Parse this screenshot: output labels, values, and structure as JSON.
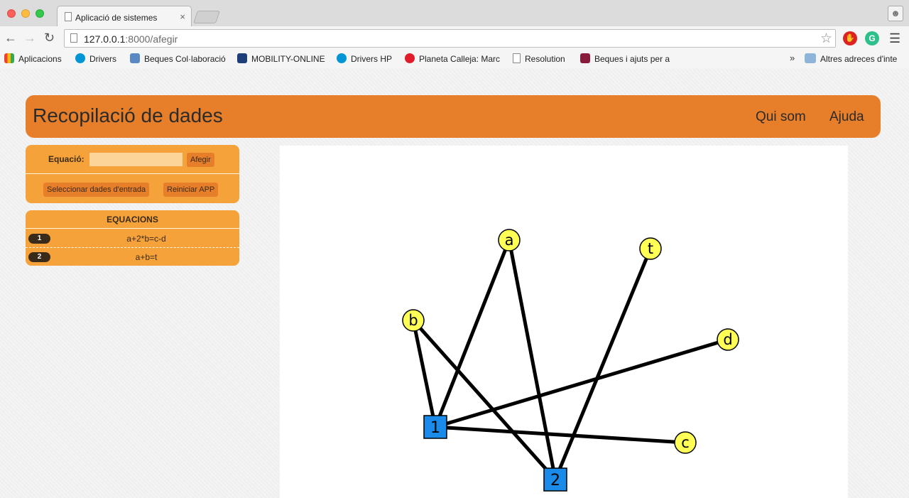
{
  "browser": {
    "tab_title": "Aplicació de sistemes",
    "tab_close": "×",
    "url_host": "127.0.0.1",
    "url_path": ":8000/afegir",
    "bookmarks": [
      {
        "label": "Aplicacions",
        "icon": "apps-grid-icon",
        "color": "#4285f4"
      },
      {
        "label": "Drivers",
        "icon": "hp-logo-icon",
        "color": "#0096d6"
      },
      {
        "label": "Beques Col·laboració",
        "icon": "ministry-logo-icon",
        "color": "#5a8ac6"
      },
      {
        "label": "MOBILITY-ONLINE",
        "icon": "mobility-logo-icon",
        "color": "#1c3f7a"
      },
      {
        "label": "Drivers HP",
        "icon": "hp-logo-icon",
        "color": "#0096d6"
      },
      {
        "label": "Planeta Calleja: Marc",
        "icon": "planeta-logo-icon",
        "color": "#e11d2b"
      },
      {
        "label": "Resolution",
        "icon": "document-icon",
        "color": "#ffffff"
      },
      {
        "label": "Beques i ajuts per a",
        "icon": "agaur-logo-icon",
        "color": "#8a1c3b"
      }
    ],
    "bookmarks_more": "»",
    "other_bookmarks": "Altres adreces d'inte"
  },
  "header": {
    "title": "Recopilació de dades",
    "nav": [
      "Qui som",
      "Ajuda"
    ]
  },
  "form": {
    "label": "Equació:",
    "input_value": "",
    "add_button": "Afegir",
    "select_button": "Seleccionar dades d'entrada",
    "reset_button": "Reiniciar APP"
  },
  "equations": {
    "title": "EQUACIONS",
    "items": [
      {
        "badge": "1",
        "text": "a+2*b=c-d"
      },
      {
        "badge": "2",
        "text": "a+b=t"
      }
    ]
  },
  "graph": {
    "equation_nodes": [
      "1",
      "2"
    ],
    "variable_nodes": [
      "a",
      "t",
      "b",
      "d",
      "c"
    ],
    "edges": [
      [
        "1",
        "a"
      ],
      [
        "1",
        "b"
      ],
      [
        "1",
        "d"
      ],
      [
        "1",
        "c"
      ],
      [
        "2",
        "a"
      ],
      [
        "2",
        "b"
      ],
      [
        "2",
        "t"
      ]
    ],
    "colors": {
      "equation_node": "#1a8be8",
      "variable_node": "#ffff55",
      "edge": "#000000"
    }
  },
  "colors": {
    "accent": "#e67e2a",
    "panel": "#f6a23a"
  }
}
